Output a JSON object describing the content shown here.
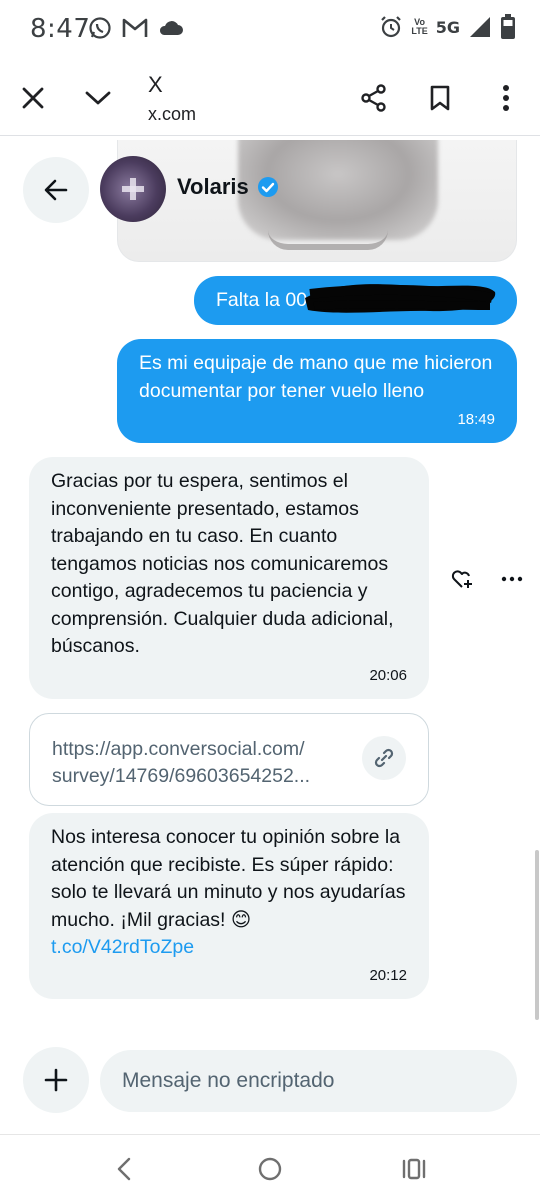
{
  "status_bar": {
    "time": "8:47",
    "network_label": "5G",
    "volte_top": "Vo",
    "volte_bottom": "LTE"
  },
  "browser": {
    "page_title": "X",
    "url": "x.com"
  },
  "chat": {
    "contact_name": "Volaris",
    "messages": [
      {
        "direction": "outgoing",
        "text": "Falta la 00",
        "time": ""
      },
      {
        "direction": "outgoing",
        "text": "Es mi equipaje de mano que me hicieron documentar por tener vuelo lleno",
        "time": "18:49"
      },
      {
        "direction": "incoming",
        "text": "Gracias por tu espera, sentimos el inconveniente presentado, estamos trabajando en tu caso. En cuanto tengamos noticias nos comunicaremos contigo, agradecemos tu paciencia y comprensión. Cualquier duda adicional, búscanos.",
        "time": "20:06"
      },
      {
        "direction": "incoming",
        "link_line1": "https://app.conversocial.com/",
        "link_line2": "survey/14769/69603654252..."
      },
      {
        "direction": "incoming",
        "text": "Nos interesa conocer tu opinión sobre la atención que recibiste. Es súper rápido: solo te llevará un minuto y nos ayudarías mucho. ¡Mil gracias! 😊",
        "link": "t.co/V42rdToZpe",
        "time": "20:12"
      }
    ]
  },
  "composer": {
    "placeholder": "Mensaje no encriptado"
  },
  "colors": {
    "accent": "#1d9bf0",
    "incoming_bubble": "#eff3f4",
    "text": "#0f1419",
    "secondary_text": "#536471"
  },
  "icons": {
    "status": [
      "whatsapp-icon",
      "gmail-icon",
      "cloud-icon",
      "alarm-icon",
      "signal-icon",
      "battery-icon"
    ],
    "toolbar": [
      "close-icon",
      "chevron-down-icon",
      "share-icon",
      "bookmark-icon",
      "more-vertical-icon"
    ],
    "chat": [
      "back-arrow-icon",
      "verified-badge-icon",
      "add-reaction-icon",
      "more-horizontal-icon",
      "link-icon",
      "plus-icon"
    ],
    "nav": [
      "nav-back-icon",
      "nav-home-icon",
      "nav-recents-icon"
    ]
  }
}
